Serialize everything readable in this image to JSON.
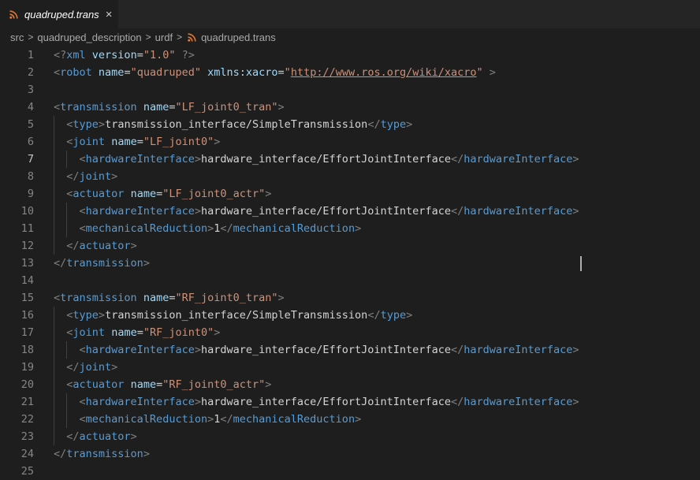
{
  "tab": {
    "label": "quadruped.trans",
    "close_glyph": "×",
    "icon": "rss-icon"
  },
  "breadcrumb": [
    "src",
    "quadruped_description",
    "urdf",
    "quadruped.trans"
  ],
  "breadcrumb_separator": ">",
  "editor": {
    "active_line": 7,
    "lines": [
      "<?xml version=\"1.0\" ?>",
      "<robot name=\"quadruped\" xmlns:xacro=\"http://www.ros.org/wiki/xacro\" >",
      "",
      "<transmission name=\"LF_joint0_tran\">",
      "  <type>transmission_interface/SimpleTransmission</type>",
      "  <joint name=\"LF_joint0\">",
      "    <hardwareInterface>hardware_interface/EffortJointInterface</hardwareInterface>",
      "  </joint>",
      "  <actuator name=\"LF_joint0_actr\">",
      "    <hardwareInterface>hardware_interface/EffortJointInterface</hardwareInterface>",
      "    <mechanicalReduction>1</mechanicalReduction>",
      "  </actuator>",
      "</transmission>",
      "",
      "<transmission name=\"RF_joint0_tran\">",
      "  <type>transmission_interface/SimpleTransmission</type>",
      "  <joint name=\"RF_joint0\">",
      "    <hardwareInterface>hardware_interface/EffortJointInterface</hardwareInterface>",
      "  </joint>",
      "  <actuator name=\"RF_joint0_actr\">",
      "    <hardwareInterface>hardware_interface/EffortJointInterface</hardwareInterface>",
      "    <mechanicalReduction>1</mechanicalReduction>",
      "  </actuator>",
      "</transmission>",
      ""
    ]
  },
  "colors": {
    "background": "#1e1e1e",
    "tag": "#569cd6",
    "attribute": "#9cdcfe",
    "string": "#ce9178",
    "bracket": "#808080",
    "text": "#d4d4d4",
    "rss_icon": "#e37933"
  }
}
